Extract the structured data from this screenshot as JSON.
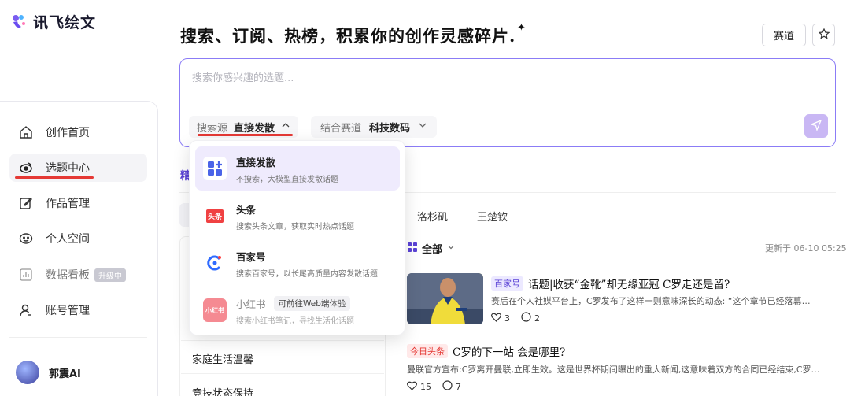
{
  "app": {
    "logo_text": "讯飞绘文"
  },
  "sidebar": {
    "items": [
      {
        "label": "创作首页",
        "icon": "home-icon"
      },
      {
        "label": "选题中心",
        "icon": "topic-center-icon",
        "active": true
      },
      {
        "label": "作品管理",
        "icon": "edit-icon"
      },
      {
        "label": "个人空间",
        "icon": "smile-icon"
      },
      {
        "label": "数据看板",
        "icon": "chart-icon",
        "badge": "升级中",
        "disabled": true
      },
      {
        "label": "账号管理",
        "icon": "user-icon"
      }
    ],
    "user": {
      "name": "郭震AI"
    }
  },
  "header": {
    "headline": "搜索、订阅、热榜，积累你的创作灵感碎片.",
    "sparkle": "✦",
    "track_button": "赛道"
  },
  "search": {
    "placeholder": "搜索你感兴趣的选题...",
    "value": "",
    "source_label": "搜索源",
    "source_value": "直接发散",
    "track_label": "结合赛道",
    "track_value": "科技数码"
  },
  "dropdown": {
    "items": [
      {
        "title": "直接发散",
        "desc": "不搜索，大模型直接发散话题",
        "icon": "grid-plus-icon",
        "active": true
      },
      {
        "title": "头条",
        "desc": "搜索头条文章，获取实时热点话题",
        "icon": "toutiao-icon",
        "icon_text": "头条"
      },
      {
        "title": "百家号",
        "desc": "搜索百家号，以长尾高质量内容发散话题",
        "icon": "baijiahao-icon"
      },
      {
        "title": "小红书",
        "desc": "搜索小红书笔记，寻找生活化话题",
        "icon": "xiaohongshu-icon",
        "icon_text": "小红书",
        "tag": "可前往Web端体验",
        "disabled": true
      }
    ]
  },
  "content": {
    "tab_partial": "精",
    "persons": [
      "洛杉矶",
      "王楚钦"
    ],
    "left_list": [
      "家庭生活温馨",
      "竞技状态保持"
    ],
    "filter_label": "全部",
    "updated_text": "更新于 06-10 05:25",
    "news": [
      {
        "source": "百家号",
        "title": "话题|收获“金靴”却无缘亚冠 C罗走还是留?",
        "desc": "赛后在个人社媒平台上，C罗发布了这样一则意味深长的动态: “这个章节已经落幕…",
        "likes": "3",
        "comments": "2"
      },
      {
        "source": "今日头条",
        "title": "C罗的下一站 会是哪里?",
        "desc": "曼联官方宣布:C罗离开曼联,立即生效。这是世界杯期间曝出的重大新闻,这意味着双方的合同已经结束,C罗…",
        "likes": "15",
        "comments": "7"
      }
    ]
  },
  "colors": {
    "accent": "#5b43d6",
    "highlight": "#e53935",
    "search_border": "#8b7cf6"
  }
}
